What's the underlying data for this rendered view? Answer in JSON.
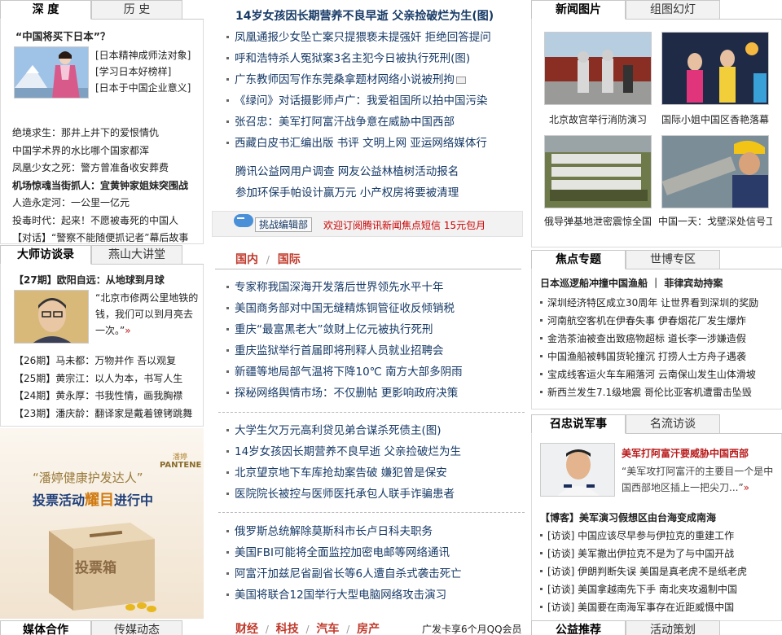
{
  "left": {
    "tabs1": [
      "深 度",
      "历 史"
    ],
    "feature_title": "“中国将买下日本”？",
    "feature_links": [
      "[日本精神成师法对象]",
      "[学习日本好榜样]",
      "[日本于中国企业意义]"
    ],
    "news1": [
      "绝境求生：那井上井下的爱恨情仇",
      "中国学术界的水比哪个国家都浑",
      "凤凰少女之死：警方曾准备收安葬费",
      "机场惊魂当街抓人：宜黄钟家姐妹突围战",
      "人造永定河：一公里一亿元",
      "投毒时代：起来！不愿被毒死的中国人",
      "【对话】“警察不能随便抓记者”幕后故事"
    ],
    "tabs2": [
      "大师访谈录",
      "燕山大讲堂"
    ],
    "interview_title": "【27期】欧阳自远：从地球到月球",
    "interview_quote": "“北京市修两公里地铁的钱，我们可以到月亮去一次。”",
    "interview_more": "»",
    "interviews": [
      "【26期】马未都：万物并作 吾以观复",
      "【25期】黄宗江：以人为本，书写人生",
      "【24期】黄永厚：书我性情，画我胸襟",
      "【23期】潘庆龄：翻译家是戴着镣铐跳舞"
    ],
    "ad_brand_cn": "潘婷",
    "ad_brand": "PANTENE",
    "ad_line1": "“潘婷健康护发达人”",
    "ad_line2a": "投票活动",
    "ad_line2b": "耀目",
    "ad_line2c": "进行中",
    "ad_box_label": "投票箱",
    "tabs3": [
      "媒体合作",
      "传媒动态"
    ]
  },
  "mid": {
    "headline": "14岁女孩因长期营养不良早逝 父亲捡破烂为生(图)",
    "top_news": [
      "凤凰通报少女坠亡案只提猥亵未提强奸 拒绝回答提问",
      "呼和浩特杀人冤狱案3名主犯今日被执行死刑(图)",
      "广东教师因写作东莞桑拿题材网络小说被刑拘",
      "《绿问》对话摄影师卢广：我爱祖国所以拍中国污染",
      "张召忠：美军打阿富汗战争意在威胁中国西部",
      "西藏白皮书汇编出版 书评 文明上网 亚运网络媒体行"
    ],
    "links_row1": "腾讯公益网用户调查 网友公益林植树活动报名",
    "links_row2": "参加环保手帕设计赢万元 小产权房将要被清理",
    "sms_btn": "挑战编辑部",
    "sms_text": "欢迎订阅腾讯新闻焦点短信 15元包月",
    "section_domestic": "国内",
    "section_sep": "/",
    "section_intl": "国际",
    "domestic": [
      "专家称我国深海开发落后世界领先水平十年",
      "美国商务部对中国无缝精炼铜管征收反倾销税",
      "重庆“最富黑老大”敛财上亿元被执行死刑",
      "重庆监狱举行首届即将刑释人员就业招聘会",
      "新疆等地局部气温将下降10℃ 南方大部多阴雨",
      "探秘网络舆情市场：不仅删帖 更影响政府决策"
    ],
    "group2": [
      "大学生欠万元高利贷见弟合谋杀死债主(图)",
      "14岁女孩因长期营养不良早逝 父亲捡破烂为生",
      "北京望京地下车库抢劫案告破 嫌犯曾是保安",
      "医院院长被控与医师医托承包人联手诈骗患者"
    ],
    "intl": [
      "俄罗斯总统解除莫斯科市长卢日科夫职务",
      "美国FBI可能将全面监控加密电邮等网络通讯",
      "阿富汗加兹尼省副省长等6人遭自杀式袭击死亡",
      "美国将联合12国举行大型电脑网络攻击演习"
    ],
    "bottom_nav": [
      "财经",
      "科技",
      "汽车",
      "房产"
    ],
    "bottom_promo": "广发卡享6个月QQ会员"
  },
  "right": {
    "tabs1": [
      "新闻图片",
      "组图幻灯"
    ],
    "photos": [
      {
        "caption": "北京故宫举行消防演习"
      },
      {
        "caption": "国际小姐中国区香艳落幕"
      },
      {
        "caption": "俄导弹基地泄密震惊全国"
      },
      {
        "caption": "中国一天：戈壁深处信号工"
      }
    ],
    "tabs2": [
      "焦点专题",
      "世博专区"
    ],
    "focus_title": "日本巡逻船冲撞中国渔船 ｜ 菲律宾劫持案",
    "focus": [
      "深圳经济特区成立30周年 让世界看到深圳的奖励",
      "河南航空客机在伊春失事 伊春烟花厂发生爆炸",
      "金浩茶油被查出致癌物超标 道长李一涉嫌造假",
      "中国渔船被韩国货轮撞沉 打捞人士方舟子遇袭",
      "宝成线客运火车车厢落河 云南保山发生山体滑坡",
      "新西兰发生7.1级地震 哥伦比亚客机遭雷击坠毁"
    ],
    "tabs3": [
      "召忠说军事",
      "名流访谈"
    ],
    "military_title": "美军打阿富汗要威胁中国西部",
    "military_quote": "“美军攻打阿富汗的主要目一个是中国西部地区插上一把尖刀...”",
    "military_more": "»",
    "blog": "【博客】美军演习假想区由台海变成南海",
    "talks": [
      "[访谈] 中国应该尽早参与伊拉克的重建工作",
      "[访谈] 美军撤出伊拉克不是为了与中国开战",
      "[访谈] 伊朗判断失误 美国是真老虎不是纸老虎",
      "[访谈] 美国拿越南先下手 南北夹攻遏制中国",
      "[访谈] 美国要在南海军事存在近距威慑中国"
    ],
    "tabs4": [
      "公益推荐",
      "活动策划"
    ]
  }
}
